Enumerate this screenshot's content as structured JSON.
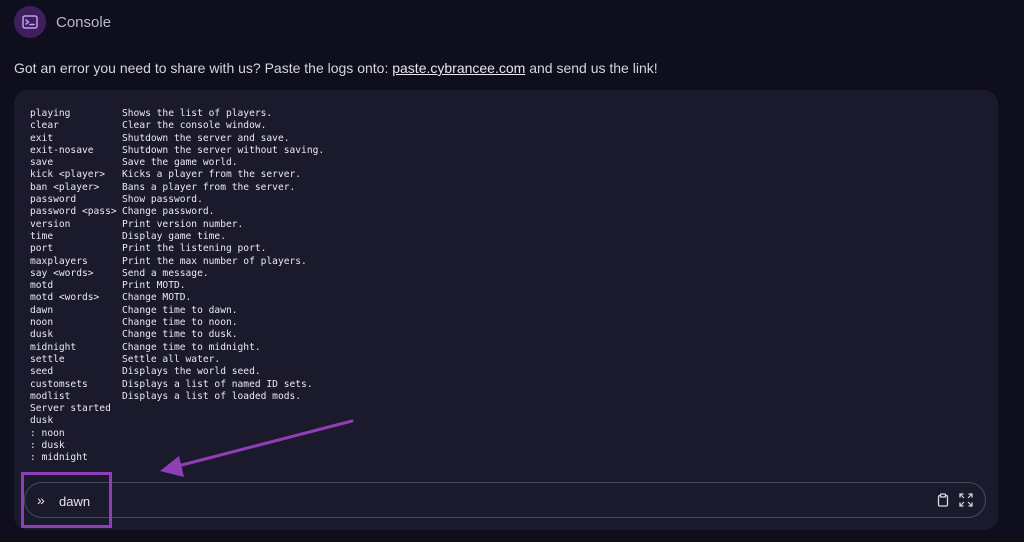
{
  "header": {
    "title": "Console",
    "icon": "terminal-icon"
  },
  "notice": {
    "prefix": "Got an error you need to share with us? Paste the logs onto: ",
    "link_text": "paste.cybrancee.com",
    "suffix": " and send us the link!"
  },
  "console": {
    "help_lines": [
      {
        "cmd": "playing",
        "desc": "Shows the list of players."
      },
      {
        "cmd": "clear",
        "desc": "Clear the console window."
      },
      {
        "cmd": "exit",
        "desc": "Shutdown the server and save."
      },
      {
        "cmd": "exit-nosave",
        "desc": "Shutdown the server without saving."
      },
      {
        "cmd": "save",
        "desc": "Save the game world."
      },
      {
        "cmd": "kick <player>",
        "desc": "Kicks a player from the server."
      },
      {
        "cmd": "ban <player>",
        "desc": "Bans a player from the server."
      },
      {
        "cmd": "password",
        "desc": "Show password."
      },
      {
        "cmd": "password <pass>",
        "desc": "Change password."
      },
      {
        "cmd": "version",
        "desc": "Print version number."
      },
      {
        "cmd": "time",
        "desc": "Display game time."
      },
      {
        "cmd": "port",
        "desc": "Print the listening port."
      },
      {
        "cmd": "maxplayers",
        "desc": "Print the max number of players."
      },
      {
        "cmd": "say <words>",
        "desc": "Send a message."
      },
      {
        "cmd": "motd",
        "desc": "Print MOTD."
      },
      {
        "cmd": "motd <words>",
        "desc": "Change MOTD."
      },
      {
        "cmd": "dawn",
        "desc": "Change time to dawn."
      },
      {
        "cmd": "noon",
        "desc": "Change time to noon."
      },
      {
        "cmd": "dusk",
        "desc": "Change time to dusk."
      },
      {
        "cmd": "midnight",
        "desc": "Change time to midnight."
      },
      {
        "cmd": "settle",
        "desc": "Settle all water."
      },
      {
        "cmd": "seed",
        "desc": "Displays the world seed."
      },
      {
        "cmd": "customsets",
        "desc": "Displays a list of named ID sets."
      },
      {
        "cmd": "modlist",
        "desc": "Displays a list of loaded mods."
      }
    ],
    "output_lines": [
      "Server started",
      "dusk",
      ": noon",
      ": dusk",
      ": midnight"
    ]
  },
  "input": {
    "prompt_icon": "chevrons-right-icon",
    "value": "dawn",
    "copy_icon": "clipboard-icon",
    "fullscreen_icon": "expand-icon"
  },
  "annotation": {
    "color": "#8e3fb7"
  }
}
